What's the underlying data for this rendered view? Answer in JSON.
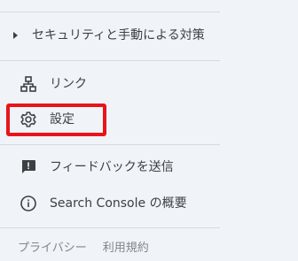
{
  "section": {
    "label": "セキュリティと手動による対策"
  },
  "menu": {
    "links_label": "リンク",
    "settings_label": "設定",
    "feedback_label": "フィードバックを送信",
    "about_label": "Search Console の概要"
  },
  "footer": {
    "privacy": "プライバシー",
    "terms": "利用規約"
  },
  "icons": {
    "section_caret": "caret-right-icon",
    "links": "sitemap-icon",
    "settings": "gear-icon",
    "feedback": "feedback-icon",
    "about": "info-icon"
  },
  "colors": {
    "background": "#f0f3f8",
    "text": "#3c4043",
    "highlight": "#e8141b"
  }
}
